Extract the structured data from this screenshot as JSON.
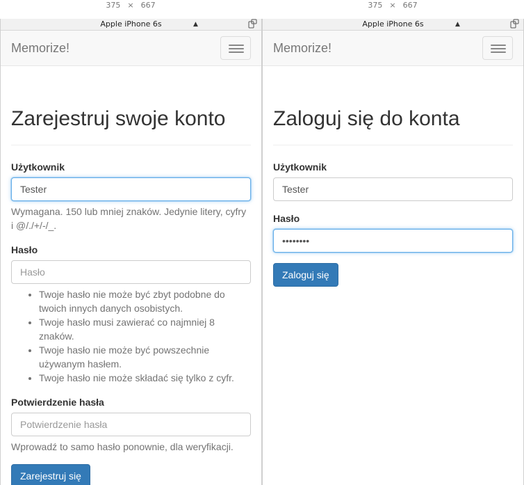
{
  "device": {
    "width": "375",
    "times": "×",
    "height": "667",
    "model": "Apple iPhone 6s"
  },
  "app": {
    "brand": "Memorize!"
  },
  "register": {
    "title": "Zarejestruj swoje konto",
    "username_label": "Użytkownik",
    "username_value": "Tester",
    "username_help": "Wymagana. 150 lub mniej znaków. Jedynie litery, cyfry i @/./+/-/_.",
    "password_label": "Hasło",
    "password_placeholder": "Hasło",
    "password_rules": [
      "Twoje hasło nie może być zbyt podobne do twoich innych danych osobistych.",
      "Twoje hasło musi zawierać co najmniej 8 znaków.",
      "Twoje hasło nie może być powszechnie używanym hasłem.",
      "Twoje hasło nie może składać się tylko z cyfr."
    ],
    "confirm_label": "Potwierdzenie hasła",
    "confirm_placeholder": "Potwierdzenie hasła",
    "confirm_help": "Wprowadź to samo hasło ponownie, dla weryfikacji.",
    "submit_label": "Zarejestruj się"
  },
  "login": {
    "title": "Zaloguj się do konta",
    "username_label": "Użytkownik",
    "username_value": "Tester",
    "password_label": "Hasło",
    "password_value": "********",
    "submit_label": "Zaloguj się"
  },
  "colors": {
    "primary": "#337ab7",
    "navbar_bg": "#f8f8f8",
    "focus_border": "#66afe9",
    "help_text": "#737373"
  }
}
